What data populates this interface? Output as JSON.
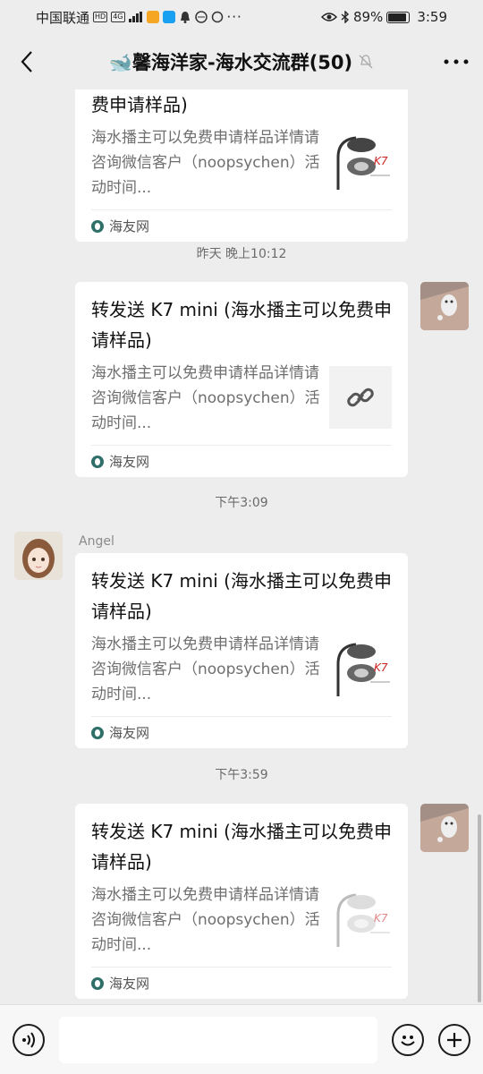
{
  "status_bar": {
    "carrier": "中国联通",
    "badges": [
      "HD",
      "4G"
    ],
    "app_icon_colors": [
      "#f5a623",
      "#1aa0f0"
    ],
    "more_dots": "···",
    "battery_percent": "89%",
    "battery_level": 0.89,
    "time": "3:59"
  },
  "header": {
    "title": "🐋馨海洋家-海水交流群(50)"
  },
  "messages": [
    {
      "type": "shared-link",
      "side": "left",
      "title_partial": "费申请样品)",
      "description": "海水播主可以免费申请样品详情请咨询微信客户（noopsychen）活动时间...",
      "thumbnail": "product-lamp",
      "source": "海友网"
    },
    {
      "type": "timestamp",
      "text": "昨天 晚上10:12"
    },
    {
      "type": "shared-link",
      "side": "right",
      "title": "转发送 K7 mini (海水播主可以免费申请样品)",
      "description": "海水播主可以免费申请样品详情请咨询微信客户（noopsychen）活动时间...",
      "thumbnail": "link-icon",
      "source": "海友网"
    },
    {
      "type": "timestamp",
      "text": "下午3:09"
    },
    {
      "type": "shared-link",
      "side": "left",
      "sender": "Angel",
      "title": "转发送 K7 mini (海水播主可以免费申请样品)",
      "description": "海水播主可以免费申请样品详情请咨询微信客户（noopsychen）活动时间...",
      "thumbnail": "product-lamp",
      "source": "海友网"
    },
    {
      "type": "timestamp",
      "text": "下午3:59"
    },
    {
      "type": "shared-link",
      "side": "right",
      "title": "转发送 K7 mini (海水播主可以免费申请样品)",
      "description": "海水播主可以免费申请样品详情请咨询微信客户（noopsychen）活动时间...",
      "thumbnail": "product-lamp-faded",
      "source": "海友网"
    }
  ],
  "input_bar": {
    "placeholder": ""
  },
  "colors": {
    "background": "#ededed",
    "bubble": "#ffffff",
    "accent_brand": "#cc2222",
    "source_icon": "#2e6f6a"
  }
}
